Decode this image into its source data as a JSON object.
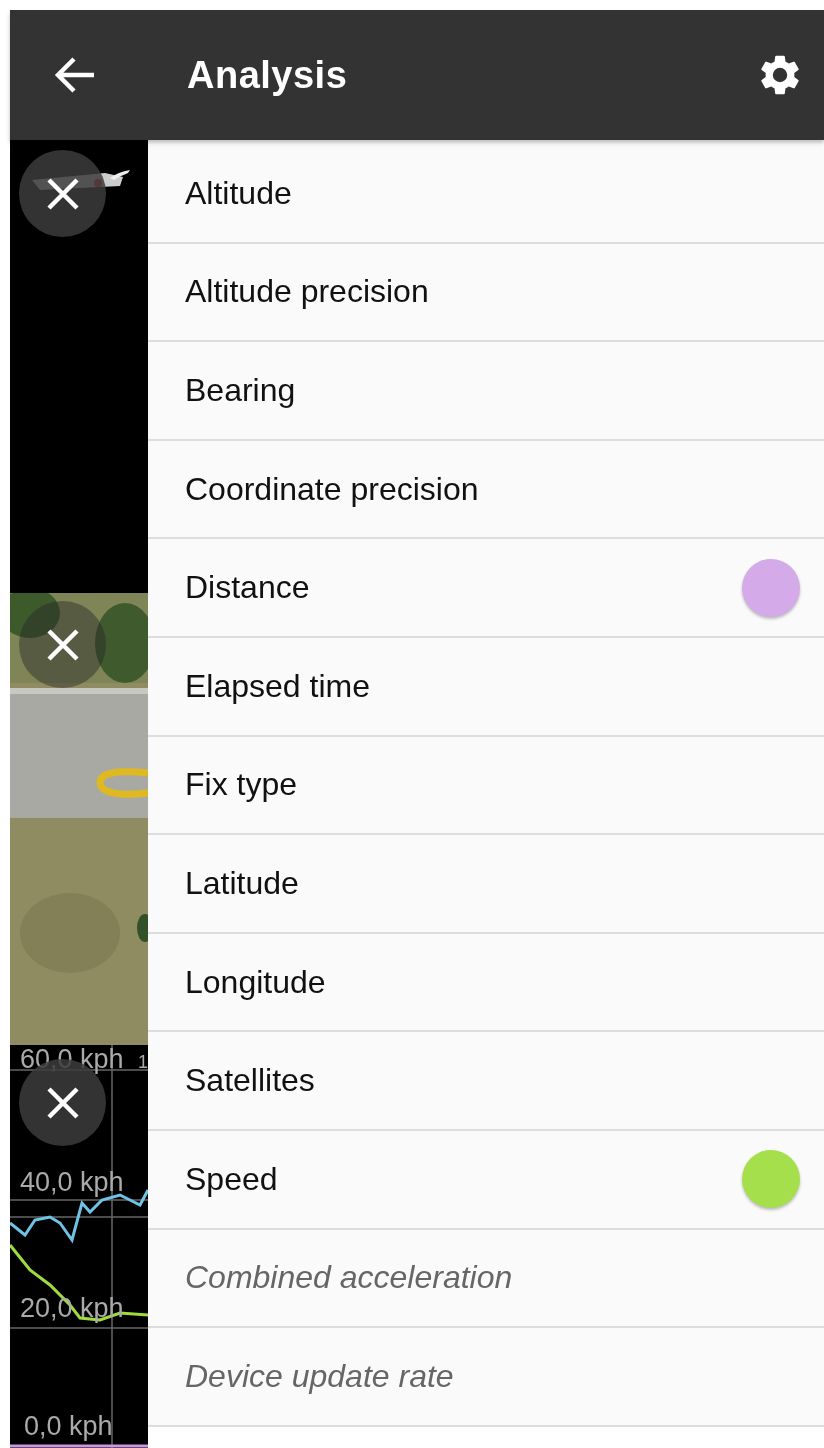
{
  "header": {
    "title": "Analysis"
  },
  "side_panels": [
    {
      "kind": "video"
    },
    {
      "kind": "map"
    },
    {
      "kind": "chart",
      "tick_labels": [
        "60,0 kph",
        "1",
        "40,0 kph",
        "20,0 kph",
        "0,0 kph"
      ]
    }
  ],
  "metrics": [
    {
      "label": "Altitude",
      "kind": "available"
    },
    {
      "label": "Altitude precision",
      "kind": "available"
    },
    {
      "label": "Bearing",
      "kind": "available"
    },
    {
      "label": "Coordinate precision",
      "kind": "available"
    },
    {
      "label": "Distance",
      "kind": "available",
      "color": "#d4aae8"
    },
    {
      "label": "Elapsed time",
      "kind": "available"
    },
    {
      "label": "Fix type",
      "kind": "available"
    },
    {
      "label": "Latitude",
      "kind": "available"
    },
    {
      "label": "Longitude",
      "kind": "available"
    },
    {
      "label": "Satellites",
      "kind": "available"
    },
    {
      "label": "Speed",
      "kind": "available",
      "color": "#a5e04c"
    },
    {
      "label": "Combined acceleration",
      "kind": "unavailable"
    },
    {
      "label": "Device update rate",
      "kind": "unavailable"
    }
  ]
}
